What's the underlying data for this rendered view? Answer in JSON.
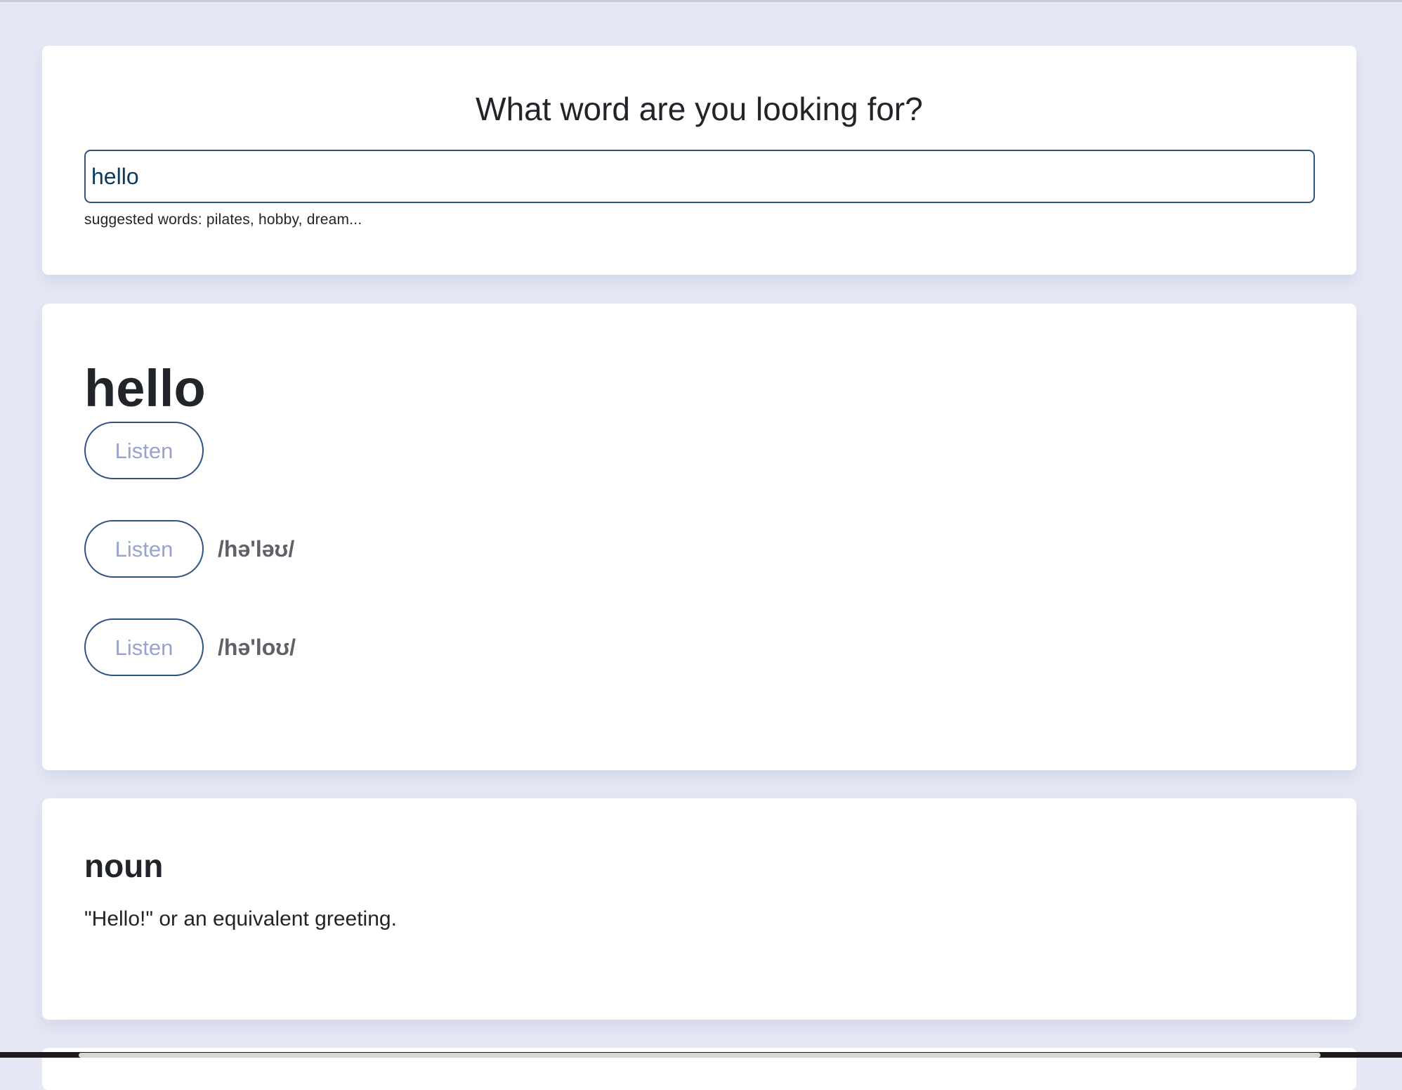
{
  "search": {
    "title": "What word are you looking for?",
    "value": "hello",
    "suggestions": "suggested words: pilates, hobby, dream..."
  },
  "word": {
    "headword": "hello",
    "listen_label": "Listen",
    "pronunciations": [
      {
        "label": "Listen",
        "phonetic": "/hə'ləʊ/"
      },
      {
        "label": "Listen",
        "phonetic": "/hə'loʊ/"
      }
    ]
  },
  "meaning": {
    "part_of_speech": "noun",
    "definition": "\"Hello!\" or an equivalent greeting."
  },
  "colors": {
    "background": "#e6e9f5",
    "card": "#ffffff",
    "accent_border": "#2f5480",
    "listen_text": "#9aa3d0",
    "phonetic_text": "#5f6168"
  }
}
